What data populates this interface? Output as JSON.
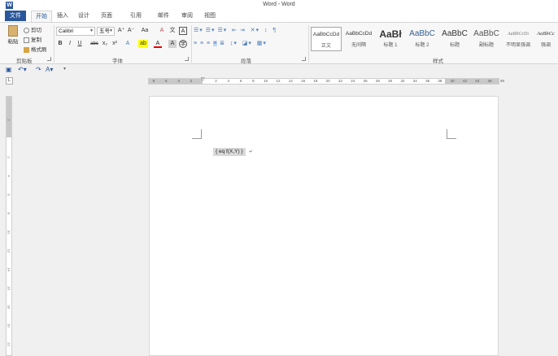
{
  "window": {
    "title": "Word - Word"
  },
  "tabs": {
    "file": "文件",
    "items": [
      "开始",
      "插入",
      "设计",
      "页面布局",
      "引用",
      "邮件",
      "审阅",
      "视图"
    ]
  },
  "clipboard": {
    "paste": "粘贴",
    "cut": "剪切",
    "copy": "复制",
    "format_painter": "格式刷",
    "label": "剪贴板"
  },
  "font": {
    "name": "Calibri",
    "size": "五号",
    "grow": "A⁺",
    "shrink": "A⁻",
    "case": "Aa",
    "clear": "A",
    "phonetic": "文",
    "border": "A",
    "bold": "B",
    "italic": "I",
    "underline": "U",
    "strike": "abc",
    "subscript": "x₂",
    "superscript": "x²",
    "effects": "A",
    "highlight": "ab",
    "color": "A",
    "shading": "A",
    "enclosed": "字",
    "label": "字体"
  },
  "paragraph": {
    "label": "段落"
  },
  "styles": {
    "label": "样式",
    "items": [
      {
        "sample": "AaBbCcDd",
        "name": "正文"
      },
      {
        "sample": "AaBbCcDd",
        "name": "无间隔"
      },
      {
        "sample": "AaBł",
        "name": "标题 1"
      },
      {
        "sample": "AaBbC",
        "name": "标题 2"
      },
      {
        "sample": "AaBbC",
        "name": "标题"
      },
      {
        "sample": "AaBbC",
        "name": "副标题"
      },
      {
        "sample": "AaBbCcDı",
        "name": "不明显强调"
      },
      {
        "sample": "AaBbCc",
        "name": "强调"
      }
    ]
  },
  "ruler": {
    "h_ticks": [
      "8",
      "6",
      "4",
      "2",
      "",
      "2",
      "4",
      "6",
      "8",
      "10",
      "12",
      "14",
      "16",
      "18",
      "20",
      "22",
      "24",
      "26",
      "28",
      "30",
      "32",
      "34",
      "36",
      "38",
      "40",
      "42",
      "44",
      "46",
      "48"
    ],
    "v_ticks": [
      "2",
      "",
      "2",
      "4",
      "6",
      "8",
      "10",
      "12",
      "14",
      "16",
      "18",
      "20",
      "22"
    ],
    "corner": "L"
  },
  "document": {
    "field_code": "{ eq f(X,Y) }",
    "para_mark": "↵"
  },
  "colors": {
    "accent": "#2b579a",
    "ribbon_bg": "#f7f7f7",
    "canvas_bg": "#f0f0f0"
  }
}
